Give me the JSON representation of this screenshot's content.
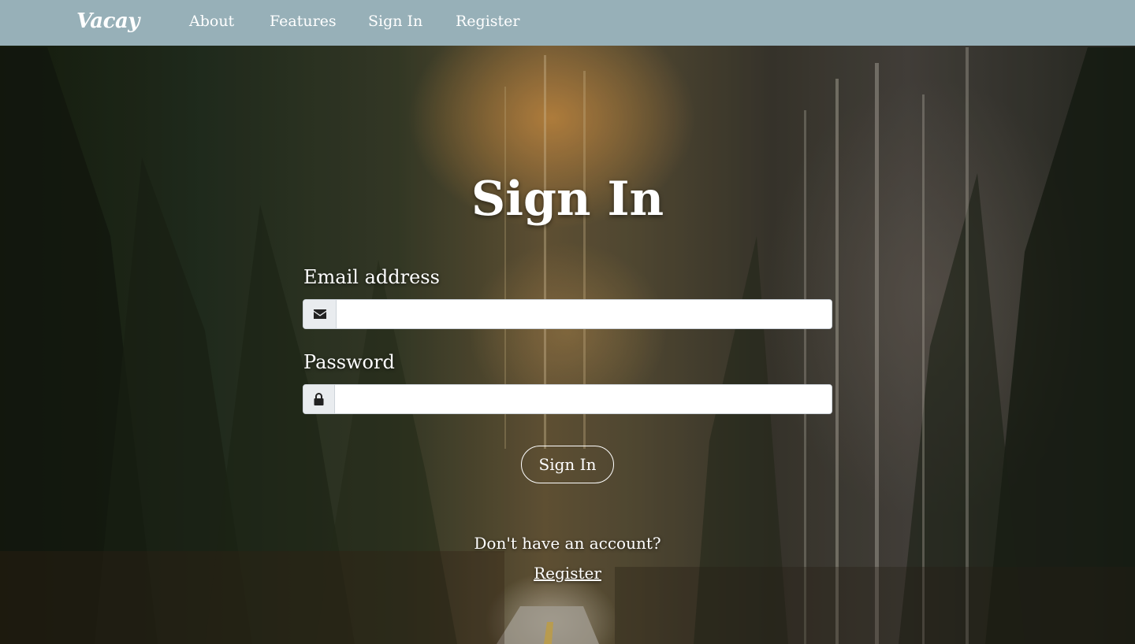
{
  "navbar": {
    "brand": "Vacay",
    "links": [
      {
        "label": "About"
      },
      {
        "label": "Features"
      },
      {
        "label": "Sign In"
      },
      {
        "label": "Register"
      }
    ],
    "background": "#97b0b8"
  },
  "form": {
    "title": "Sign In",
    "email": {
      "label": "Email address",
      "value": "",
      "placeholder": "",
      "icon": "envelope-icon"
    },
    "password": {
      "label": "Password",
      "value": "",
      "placeholder": "",
      "icon": "lock-icon"
    },
    "submit_label": "Sign In"
  },
  "footer": {
    "prompt": "Don't have an account?",
    "register_label": "Register"
  },
  "background_image": "forest-road-scene"
}
